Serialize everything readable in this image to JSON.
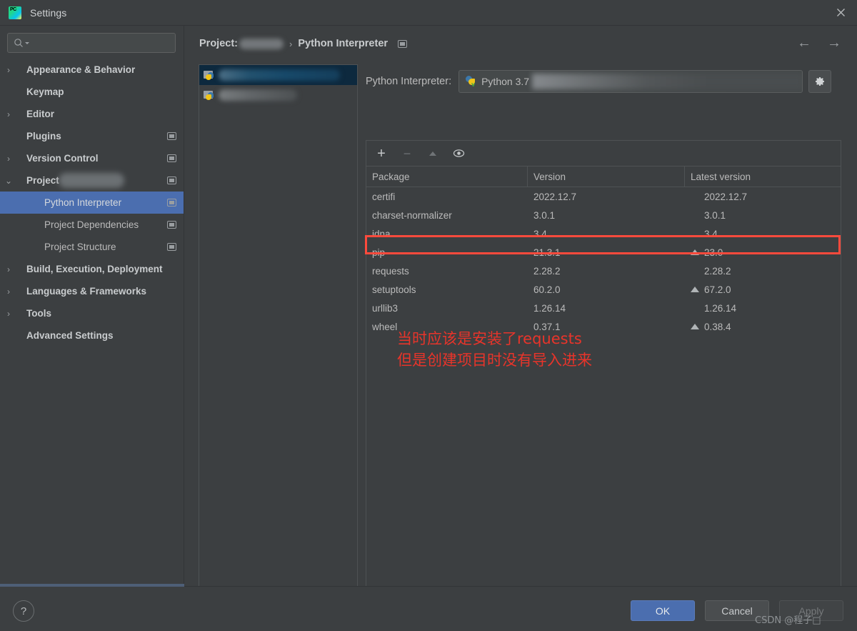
{
  "window": {
    "title": "Settings",
    "logo_icon": "pycharm-logo-icon",
    "close_icon": "close-icon"
  },
  "sidebar": {
    "search": {
      "placeholder": "",
      "value": "",
      "icon": "search-icon"
    },
    "items": [
      {
        "label": "Appearance & Behavior",
        "arrow": "›",
        "expandable": true,
        "level": 0,
        "badge": false,
        "selected": false
      },
      {
        "label": "Keymap",
        "arrow": "",
        "expandable": false,
        "level": 0,
        "badge": false,
        "selected": false
      },
      {
        "label": "Editor",
        "arrow": "›",
        "expandable": true,
        "level": 0,
        "badge": false,
        "selected": false
      },
      {
        "label": "Plugins",
        "arrow": "",
        "expandable": false,
        "level": 0,
        "badge": true,
        "selected": false
      },
      {
        "label": "Version Control",
        "arrow": "›",
        "expandable": true,
        "level": 0,
        "badge": true,
        "selected": false
      },
      {
        "label": "Project",
        "arrow": "⌄",
        "expandable": true,
        "level": 0,
        "badge": true,
        "selected": false,
        "redacted": true
      },
      {
        "label": "Python Interpreter",
        "arrow": "",
        "expandable": false,
        "level": 1,
        "badge": true,
        "selected": true
      },
      {
        "label": "Project Dependencies",
        "arrow": "",
        "expandable": false,
        "level": 1,
        "badge": true,
        "selected": false
      },
      {
        "label": "Project Structure",
        "arrow": "",
        "expandable": false,
        "level": 1,
        "badge": true,
        "selected": false
      },
      {
        "label": "Build, Execution, Deployment",
        "arrow": "›",
        "expandable": true,
        "level": 0,
        "badge": false,
        "selected": false
      },
      {
        "label": "Languages & Frameworks",
        "arrow": "›",
        "expandable": true,
        "level": 0,
        "badge": false,
        "selected": false
      },
      {
        "label": "Tools",
        "arrow": "›",
        "expandable": true,
        "level": 0,
        "badge": false,
        "selected": false
      },
      {
        "label": "Advanced Settings",
        "arrow": "",
        "expandable": false,
        "level": 0,
        "badge": false,
        "selected": false
      }
    ]
  },
  "content": {
    "breadcrumb": {
      "root": "Project:",
      "root_redacted": true,
      "separator": "›",
      "current": "Python Interpreter",
      "badge_icon": "project-scope-badge-icon"
    },
    "nav": {
      "back_icon": "arrow-left-icon",
      "forward_icon": "arrow-right-icon"
    },
    "project_list": {
      "items": [
        {
          "icon": "python-env-icon",
          "label": "",
          "redacted": true,
          "selected": true
        },
        {
          "icon": "python-env-icon",
          "label": "",
          "redacted": true,
          "selected": false
        }
      ]
    },
    "interpreter": {
      "label": "Python Interpreter:",
      "icon": "python-venv-icon",
      "value": "Python 3.7",
      "path_redacted": true,
      "gear_icon": "gear-icon"
    },
    "packages": {
      "toolbar": [
        {
          "name": "add-package-button",
          "glyph": "+",
          "icon": "plus-icon",
          "disabled": false
        },
        {
          "name": "remove-package-button",
          "glyph": "−",
          "icon": "minus-icon",
          "disabled": true
        },
        {
          "name": "upgrade-package-button",
          "glyph": "▲",
          "icon": "up-arrow-icon",
          "disabled": true
        },
        {
          "name": "show-early-releases-button",
          "glyph": "◉",
          "icon": "eye-icon",
          "disabled": false
        }
      ],
      "columns": [
        "Package",
        "Version",
        "Latest version"
      ],
      "rows": [
        {
          "package": "certifi",
          "version": "2022.12.7",
          "latest": "2022.12.7",
          "upgradable": false
        },
        {
          "package": "charset-normalizer",
          "version": "3.0.1",
          "latest": "3.0.1",
          "upgradable": false
        },
        {
          "package": "idna",
          "version": "3.4",
          "latest": "3.4",
          "upgradable": false
        },
        {
          "package": "pip",
          "version": "21.3.1",
          "latest": "23.0",
          "upgradable": true
        },
        {
          "package": "requests",
          "version": "2.28.2",
          "latest": "2.28.2",
          "upgradable": false,
          "highlighted": true
        },
        {
          "package": "setuptools",
          "version": "60.2.0",
          "latest": "67.2.0",
          "upgradable": true
        },
        {
          "package": "urllib3",
          "version": "1.26.14",
          "latest": "1.26.14",
          "upgradable": false
        },
        {
          "package": "wheel",
          "version": "0.37.1",
          "latest": "0.38.4",
          "upgradable": true
        }
      ]
    },
    "annotation": {
      "line1": "当时应该是安装了requests",
      "line2": "但是创建项目时没有导入进来",
      "color": "#e8342a"
    },
    "highlight_color": "#fc4a3c"
  },
  "footer": {
    "help_label": "?",
    "help_icon": "help-icon",
    "ok_label": "OK",
    "cancel_label": "Cancel",
    "apply_label": "Apply",
    "apply_disabled": true,
    "watermark": "CSDN @程子□"
  },
  "colors": {
    "background": "#3c3f41",
    "selection_blue": "#4b6eaf",
    "text": "#bbbbbb",
    "border": "#4e5254",
    "accent_red": "#e8342a"
  }
}
